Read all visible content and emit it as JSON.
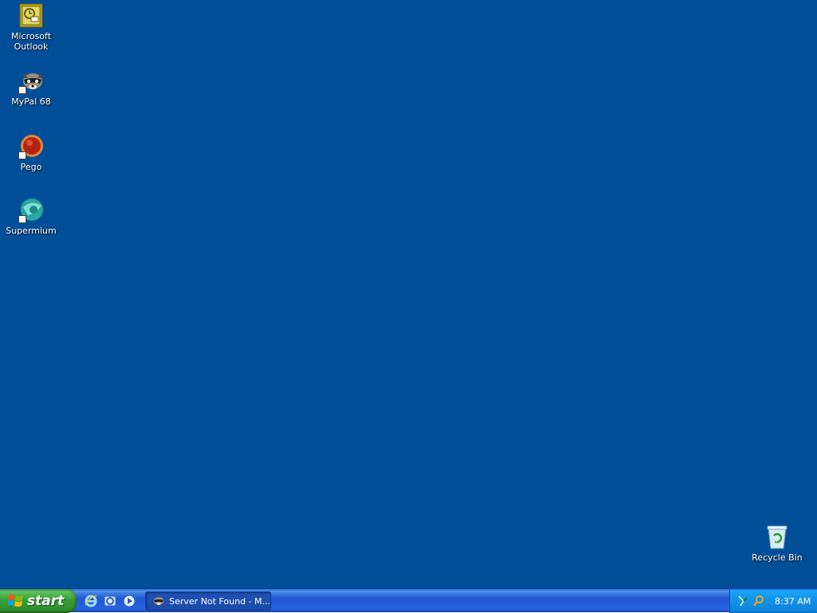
{
  "desktop": {
    "background_color": "#004e98",
    "icons": [
      {
        "label": "Microsoft\nOutlook",
        "icon": "outlook-icon"
      },
      {
        "label": "MyPal 68",
        "icon": "mypal-raccoon-icon"
      },
      {
        "label": "Pego",
        "icon": "pego-icon"
      },
      {
        "label": "Supermium",
        "icon": "supermium-icon"
      },
      {
        "label": "Recycle Bin",
        "icon": "recycle-bin-icon"
      }
    ]
  },
  "taskbar": {
    "start_label": "start",
    "quick_launch": [
      {
        "icon": "internet-explorer-icon"
      },
      {
        "icon": "outlook-express-icon"
      },
      {
        "icon": "media-player-icon"
      }
    ],
    "tasks": [
      {
        "label": "Server Not Found - M...",
        "icon": "mypal-raccoon-icon"
      }
    ],
    "tray": {
      "icons": [
        "network-icon",
        "search-icon"
      ],
      "clock": "8:37 AM"
    }
  }
}
